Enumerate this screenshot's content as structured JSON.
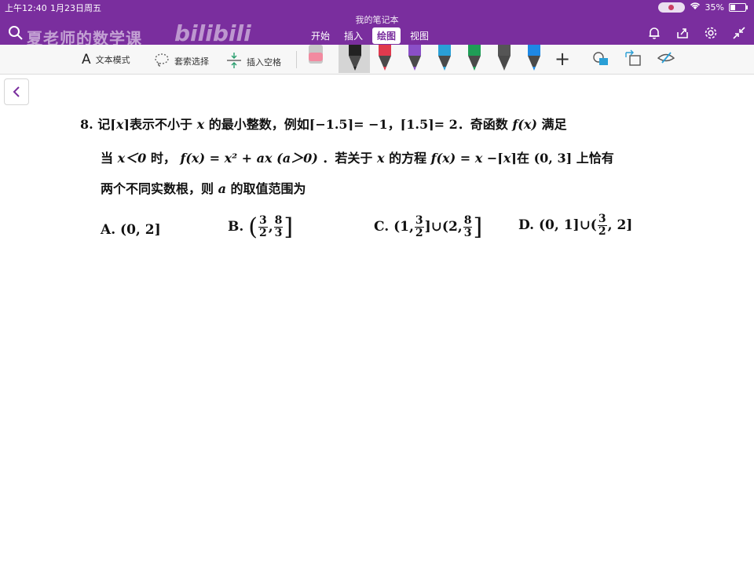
{
  "status": {
    "time": "上午12:40",
    "date": "1月23日周五",
    "battery": "35%",
    "battery_level": 0.35
  },
  "app": {
    "notebook_title": "我的笔记本",
    "watermark": "夏老师的数学课",
    "bili_logo": "bilibili",
    "tabs": [
      {
        "label": "开始"
      },
      {
        "label": "插入"
      },
      {
        "label": "绘图"
      },
      {
        "label": "视图"
      }
    ],
    "active_tab": "绘图"
  },
  "ribbon": {
    "text_mode": "文本模式",
    "text_mode_glyph": "A",
    "lasso": "套索选择",
    "insert_space": "插入空格",
    "pen_colors": [
      "#222222",
      "#e03a4e",
      "#8a4fc7",
      "#2a9fd6",
      "#1f9d56",
      "#555555",
      "#1e88e5"
    ],
    "add_glyph": "+"
  },
  "problem": {
    "number": "8.",
    "line1_a": "记",
    "ceil_x": "x",
    "line1_b": "表示不小于",
    "var_x": "x",
    "line1_c": "的最小整数，例如",
    "ex1": "−1.5",
    "ex1_val": "= −1，",
    "ex2": "1.5",
    "ex2_val": "= 2．奇函数",
    "fx": "f(x)",
    "line1_d": "满足",
    "line2_a": "当",
    "cond": "x＜0",
    "line2_b": "时，",
    "fdef": "f(x) = x² + ax (a＞0)",
    "line2_c": "．若关于",
    "line2_d": "的方程",
    "eq": "f(x) = x −",
    "line2_e": "在",
    "interval": "(0, 3]",
    "line2_f": "上恰有",
    "line3_a": "两个不同实数根，则",
    "var_a": "a",
    "line3_b": "的取值范围为"
  },
  "options": {
    "A": {
      "label": "A.",
      "text": "(0, 2]"
    },
    "B": {
      "label": "B.",
      "open": "(",
      "n1": "3",
      "d1": "2",
      "sep": ",",
      "n2": "8",
      "d2": "3",
      "close": "]"
    },
    "C": {
      "label": "C.",
      "p1": "(1,",
      "n1": "3",
      "d1": "2",
      "mid": "]∪(2,",
      "n2": "8",
      "d2": "3",
      "close": "]"
    },
    "D": {
      "label": "D.",
      "p1": "(0, 1]∪(",
      "n1": "3",
      "d1": "2",
      "close": ", 2]"
    }
  }
}
